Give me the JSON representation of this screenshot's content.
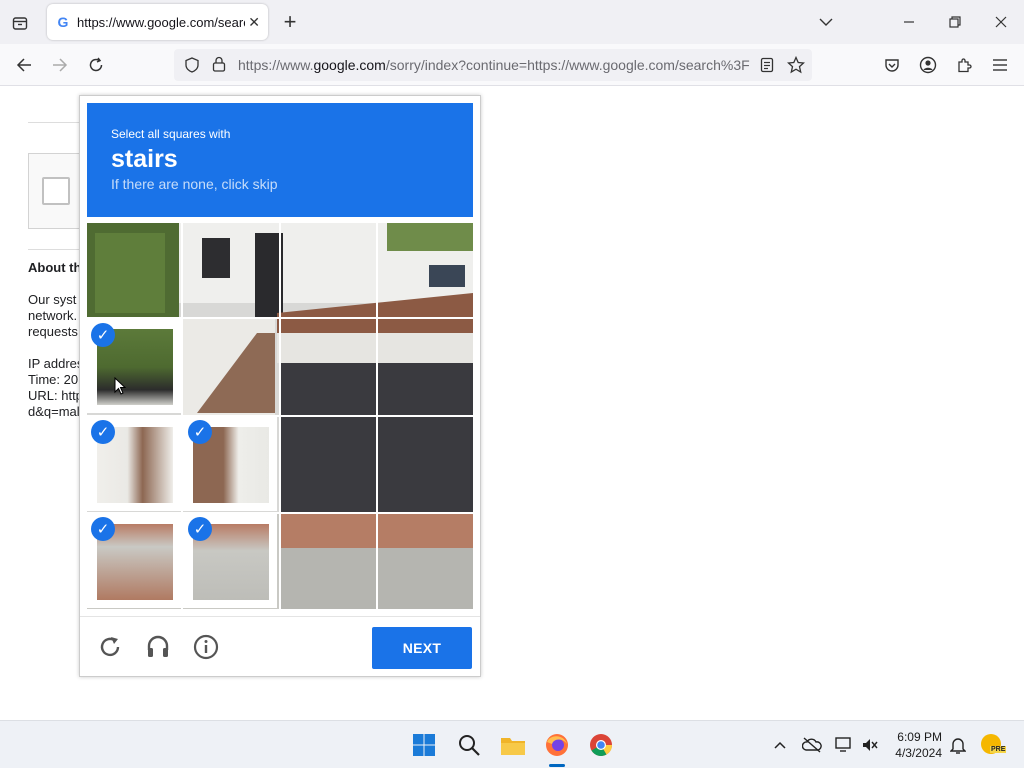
{
  "browser": {
    "tab_title": "https://www.google.com/search",
    "new_tab_label": "+",
    "url_prefix": "https://www.",
    "url_domain": "google.com",
    "url_rest": "/sorry/index?continue=https://www.google.com/search%3F"
  },
  "background_page": {
    "heading": "About th",
    "lines": [
      "Our syst",
      "network.",
      "requests"
    ],
    "ip_line": "IP addres",
    "time_line": "Time: 20",
    "url_line": "URL: http",
    "query_line": "d&q=mal"
  },
  "captcha": {
    "instruction": "Select all squares with",
    "target": "stairs",
    "skip_hint": "If there are none, click skip",
    "next_label": "NEXT",
    "check_glyph": "✓",
    "selected_tiles": [
      4,
      8,
      9,
      12,
      13
    ]
  },
  "taskbar": {
    "time": "6:09 PM",
    "date": "4/3/2024",
    "pre_badge": "PRE"
  }
}
